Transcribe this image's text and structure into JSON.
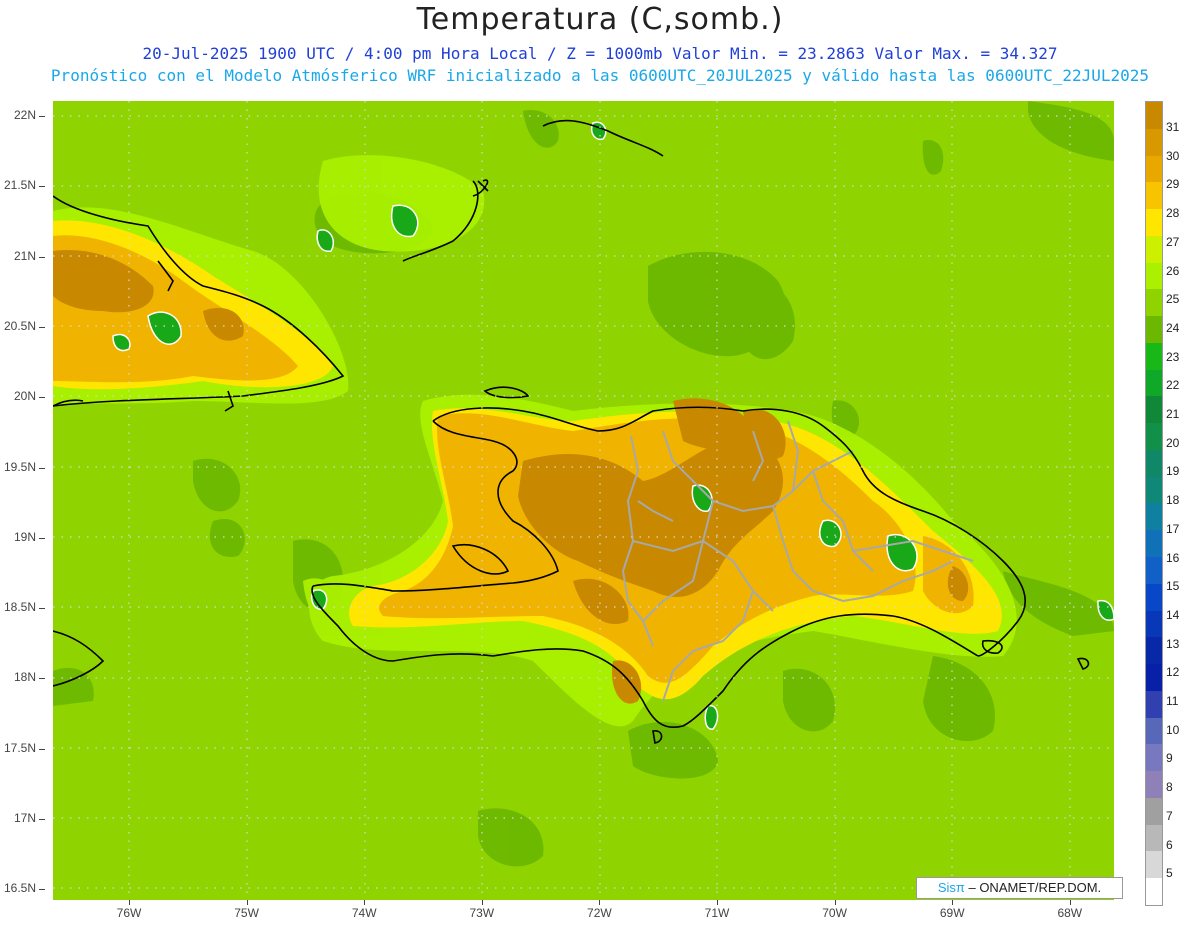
{
  "header": {
    "title": "Temperatura (C,somb.)",
    "line1": "20-Jul-2025  1900 UTC / 4:00 pm Hora Local / Z = 1000mb    Valor Min. = 23.2863  Valor Max. = 34.327",
    "line2": "Pronóstico con el Modelo Atmósferico WRF inicializado a las 0600UTC_20JUL2025 y válido hasta las  0600UTC_22JUL2025"
  },
  "map": {
    "lat_labels": [
      "22N",
      "21.5N",
      "21N",
      "20.5N",
      "20N",
      "19.5N",
      "19N",
      "18.5N",
      "18N",
      "17.5N",
      "17N",
      "16.5N"
    ],
    "lon_labels": [
      "76W",
      "75W",
      "74W",
      "73W",
      "72W",
      "71W",
      "70W",
      "69W",
      "68W"
    ],
    "colors": {
      "background": "#8fd400",
      "level_25": "#6cb800",
      "level_26": "#5aa800",
      "level_27": "#aaf000",
      "level_28": "#ffe600",
      "level_29": "#f8c000",
      "level_30": "#e0a000",
      "level_31": "#c88800",
      "level_24": "#18a818",
      "coast": "#000000",
      "provinces": "#a8a8a8"
    }
  },
  "colorbar": {
    "labels": [
      "31",
      "30",
      "29",
      "28",
      "27",
      "26",
      "25",
      "24",
      "23",
      "22",
      "21",
      "20",
      "19",
      "18",
      "17",
      "16",
      "15",
      "14",
      "13",
      "12",
      "11",
      "10",
      "9",
      "8",
      "7",
      "6",
      "5"
    ],
    "colors": [
      "#c88800",
      "#d89800",
      "#e8a800",
      "#f8c400",
      "#ffe600",
      "#ccf000",
      "#aaf000",
      "#8fd400",
      "#6cb800",
      "#18b818",
      "#10a828",
      "#108838",
      "#109048",
      "#108868",
      "#108878",
      "#1080a0",
      "#1070b8",
      "#1060c8",
      "#0848c8",
      "#0838b8",
      "#0828a8",
      "#0820a8",
      "#3040b0",
      "#5868b8",
      "#7878c0",
      "#9080b8",
      "#a0a0a0",
      "#b8b8b8",
      "#d8d8d8",
      "#ffffff"
    ]
  },
  "credit": {
    "sis": "Sisπ",
    "rest": " – ONAMET/REP.DOM."
  }
}
